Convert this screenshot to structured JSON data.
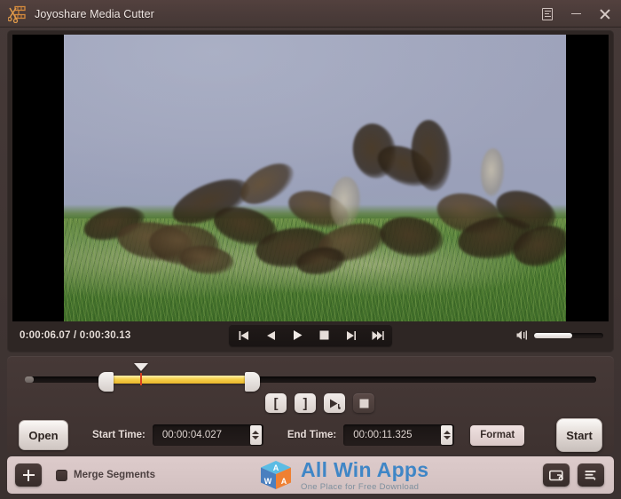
{
  "window": {
    "title": "Joyoshare Media Cutter",
    "logo_icon": "scissors-film-icon",
    "menu_icon": "menu-icon",
    "minimize_icon": "minimize-icon",
    "close_icon": "close-icon"
  },
  "player": {
    "current_time": "0:00:06.07",
    "separator": "/",
    "total_time": "0:00:30.13",
    "time_display": "0:00:06.07 / 0:00:30.13",
    "controls": [
      {
        "name": "previous-frame-button",
        "icon": "skip-back-icon"
      },
      {
        "name": "rewind-button",
        "icon": "rewind-icon"
      },
      {
        "name": "play-button",
        "icon": "play-icon"
      },
      {
        "name": "stop-button",
        "icon": "stop-icon"
      },
      {
        "name": "forward-button",
        "icon": "fast-forward-icon"
      },
      {
        "name": "next-frame-button",
        "icon": "skip-forward-icon"
      }
    ],
    "volume": {
      "icon": "volume-icon",
      "level_percent": 55
    }
  },
  "timeline": {
    "selection_start_percent": 13.2,
    "selection_end_percent": 39.4,
    "playhead_percent": 20.5,
    "progress_percent": 1.5
  },
  "trim_tools": [
    {
      "name": "set-start-marker-button",
      "label": "[",
      "style": "light"
    },
    {
      "name": "set-end-marker-button",
      "label": "]",
      "style": "light"
    },
    {
      "name": "preview-segment-button",
      "icon": "play-preview-icon",
      "style": "light"
    },
    {
      "name": "stop-preview-button",
      "icon": "stop-square-icon",
      "style": "dark"
    }
  ],
  "form": {
    "open_label": "Open",
    "start_time_label": "Start Time:",
    "start_time_value": "00:00:04.027",
    "end_time_label": "End Time:",
    "end_time_value": "00:00:11.325",
    "format_label": "Format",
    "start_label": "Start"
  },
  "bottom": {
    "add_icon": "plus-icon",
    "merge_label": "Merge Segments",
    "merge_checked": false,
    "output_folder_icon": "output-folder-icon",
    "task_list_icon": "task-list-icon"
  },
  "watermark": {
    "title": "All Win Apps",
    "tagline": "One Place for Free Download",
    "cube_letters": [
      "A",
      "W",
      "A"
    ],
    "title_color": "#3f86c6"
  },
  "theme": {
    "window_bg": "#3b3130",
    "titlebar_bg": "#4a3b39",
    "panel_bg": "#3e3230",
    "accent_yellow": "#f5cf4a",
    "playhead_red": "#d8421f",
    "bottom_bar_bg": "#d6c4c4"
  }
}
